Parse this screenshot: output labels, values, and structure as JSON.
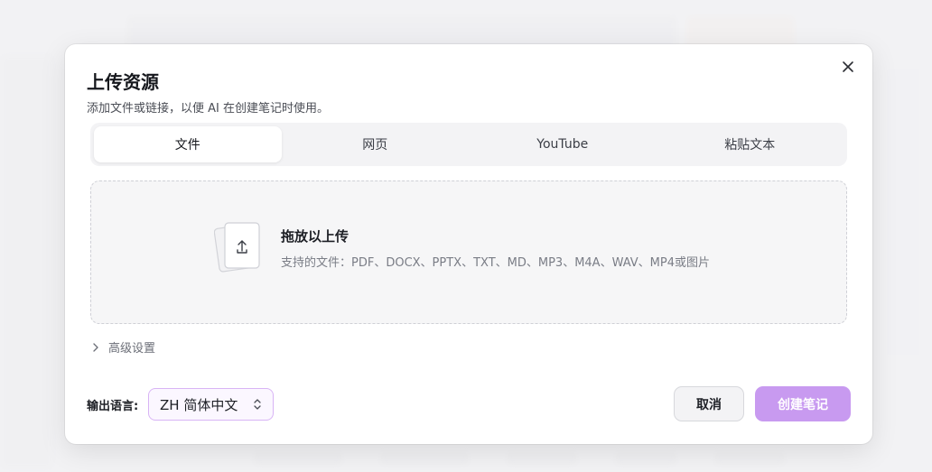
{
  "dialog": {
    "title": "上传资源",
    "subtitle": "添加文件或链接，以便 AI 在创建笔记时使用。",
    "close_icon": "close-icon"
  },
  "tabs": [
    {
      "label": "文件",
      "active": true
    },
    {
      "label": "网页",
      "active": false
    },
    {
      "label": "YouTube",
      "active": false
    },
    {
      "label": "粘贴文本",
      "active": false
    }
  ],
  "dropzone": {
    "icon": "file-upload-icon",
    "title": "拖放以上传",
    "formats": "支持的文件：PDF、DOCX、PPTX、TXT、MD、MP3、M4A、WAV、MP4或图片"
  },
  "advanced": {
    "label": "高级设置",
    "icon": "chevron-right-icon"
  },
  "output_language": {
    "label": "输出语言:",
    "selected": "ZH 简体中文",
    "icon": "chevron-up-down-icon"
  },
  "actions": {
    "cancel_label": "取消",
    "create_label": "创建笔记"
  },
  "colors": {
    "accent": "#c89af0",
    "select_border": "#d8b4f5"
  }
}
